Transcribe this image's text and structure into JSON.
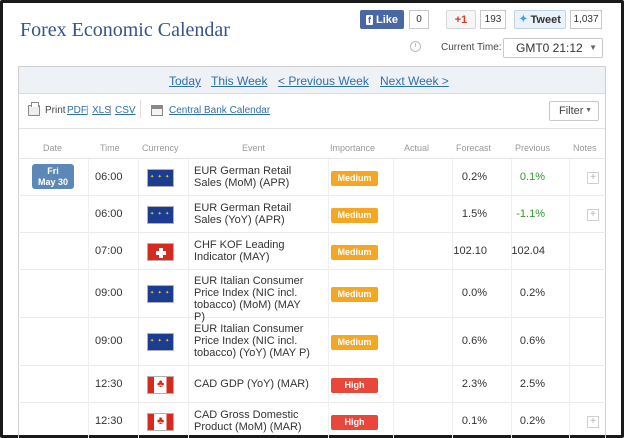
{
  "page_title": "Forex Economic Calendar",
  "social": {
    "fb_like_label": "Like",
    "fb_count": "0",
    "gplus_label": "+1",
    "gplus_count": "193",
    "tweet_label": "Tweet",
    "tweet_count": "1,037"
  },
  "time": {
    "label": "Current Time:",
    "value": "GMT0 21:12"
  },
  "nav": {
    "today": "Today",
    "this_week": "This Week",
    "previous_week": "< Previous Week",
    "next_week": "Next Week >"
  },
  "toolbar": {
    "print_label": "Print",
    "pdf": "PDF",
    "xls": "XLS",
    "csv": "CSV",
    "sep": "|",
    "central_bank": "Central Bank Calendar",
    "filter": "Filter"
  },
  "columns": [
    "Date",
    "Time",
    "Currency",
    "Event",
    "Importance",
    "Actual",
    "Forecast",
    "Previous",
    "Notes"
  ],
  "date_badge": {
    "day": "Fri",
    "date": "May 30"
  },
  "rows": [
    {
      "time": "06:00",
      "flag": "eu",
      "event": [
        "EUR German Retail",
        "Sales (MoM) (APR)"
      ],
      "importance": "Medium",
      "actual": "",
      "forecast": "0.2%",
      "previous": "0.1%",
      "previous_color": "#2e9a2e",
      "notes": true
    },
    {
      "time": "06:00",
      "flag": "eu",
      "event": [
        "EUR German Retail",
        "Sales (YoY) (APR)"
      ],
      "importance": "Medium",
      "actual": "",
      "forecast": "1.5%",
      "previous": "-1.1%",
      "previous_color": "#2e9a2e",
      "notes": true
    },
    {
      "time": "07:00",
      "flag": "ch",
      "event": [
        "CHF KOF Leading",
        "Indicator (MAY)"
      ],
      "importance": "Medium",
      "actual": "",
      "forecast": "102.10",
      "previous": "102.04",
      "previous_color": "#333333",
      "notes": false
    },
    {
      "time": "09:00",
      "flag": "eu",
      "event": [
        "EUR Italian Consumer",
        "Price Index (NIC incl.",
        "tobacco) (MoM) (MAY P)"
      ],
      "importance": "Medium",
      "actual": "",
      "forecast": "0.0%",
      "previous": "0.2%",
      "previous_color": "#333333",
      "notes": false
    },
    {
      "time": "09:00",
      "flag": "eu",
      "event": [
        "EUR Italian Consumer",
        "Price Index (NIC incl.",
        "tobacco) (YoY) (MAY P)"
      ],
      "importance": "Medium",
      "actual": "",
      "forecast": "0.6%",
      "previous": "0.6%",
      "previous_color": "#333333",
      "notes": false
    },
    {
      "time": "12:30",
      "flag": "ca",
      "event": [
        "CAD GDP (YoY) (MAR)"
      ],
      "importance": "High",
      "actual": "",
      "forecast": "2.3%",
      "previous": "2.5%",
      "previous_color": "#333333",
      "notes": false
    },
    {
      "time": "12:30",
      "flag": "ca",
      "event": [
        "CAD Gross Domestic",
        "Product (MoM) (MAR)"
      ],
      "importance": "High",
      "actual": "",
      "forecast": "0.1%",
      "previous": "0.2%",
      "previous_color": "#333333",
      "notes": true
    }
  ],
  "importance_colors": {
    "Medium": "#f5a623",
    "High": "#e8483a"
  }
}
